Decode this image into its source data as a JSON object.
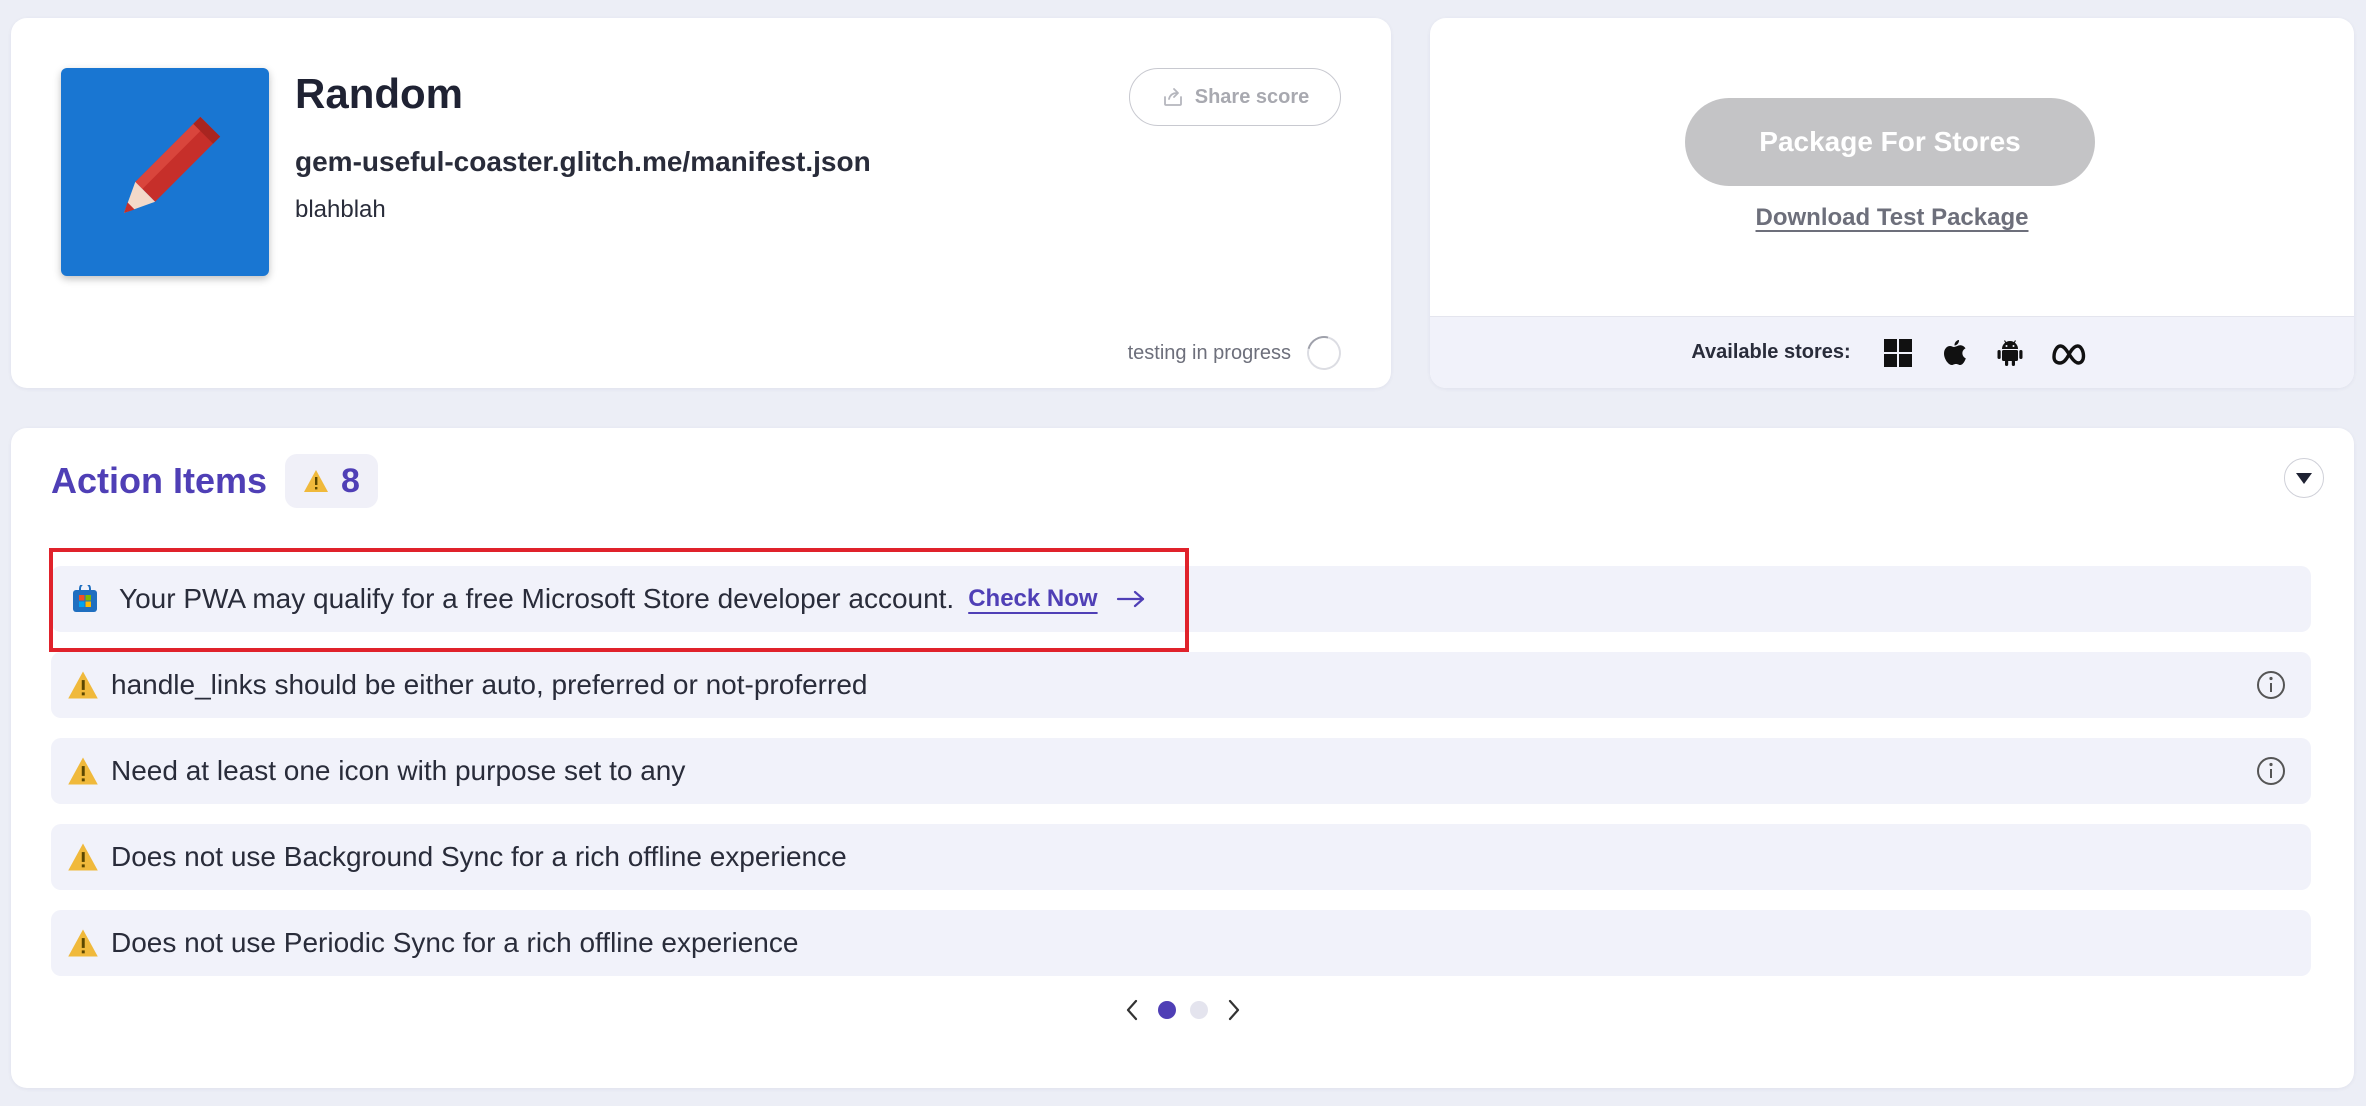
{
  "app": {
    "name": "Random",
    "url": "gem-useful-coaster.glitch.me/manifest.json",
    "description": "blahblah",
    "share_label": "Share score",
    "status_text": "testing in progress",
    "icon": "pencil-icon"
  },
  "package": {
    "button_label": "Package For Stores",
    "download_label": "Download Test Package",
    "stores_label": "Available stores:",
    "stores": [
      "windows-icon",
      "apple-icon",
      "android-icon",
      "meta-icon"
    ]
  },
  "action_items": {
    "title": "Action Items",
    "count": "8",
    "ms_promo": {
      "text": "Your PWA may qualify for a free Microsoft Store developer account.",
      "link_label": "Check Now"
    },
    "items": [
      {
        "text": "handle_links should be either auto, preferred or not-proferred",
        "has_info": true
      },
      {
        "text": "Need at least one icon with purpose set to any",
        "has_info": true
      },
      {
        "text": "Does not use Background Sync for a rich offline experience",
        "has_info": false
      },
      {
        "text": "Does not use Periodic Sync for a rich offline experience",
        "has_info": false
      }
    ],
    "pagination": {
      "current_page": 1,
      "total_pages": 2
    }
  },
  "colors": {
    "accent": "#4f3fb6",
    "warning": "#f0b93b",
    "highlight": "#e0222b",
    "app_icon_bg": "#1976d2"
  }
}
